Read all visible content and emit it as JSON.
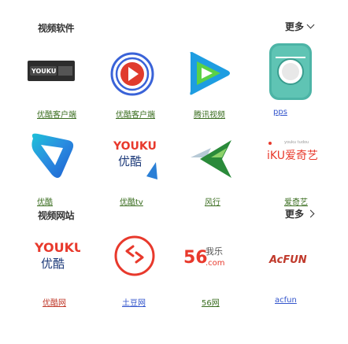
{
  "sections": [
    {
      "title": "视频软件",
      "more_label": "更多",
      "apps": [
        {
          "name": "优酷客户端",
          "icon": "youku-client-icon",
          "color": "#2a2a2a"
        },
        {
          "name": "优酷客户端",
          "icon": "youku-player-icon",
          "color": "#3a63d8"
        },
        {
          "name": "腾讯视频",
          "icon": "tencent-video-icon",
          "color": "#1e9de1"
        },
        {
          "name": "pps",
          "icon": "pps-icon",
          "color": "#3eb370"
        }
      ]
    },
    {
      "title": "视频网站",
      "more_label": "更多",
      "sites": [
        {
          "name": "优酷",
          "icon": "youku-logo-icon"
        },
        {
          "name": "优酷tv",
          "icon": "youku-tudou-logo-icon",
          "logo_line1": "YOUKU",
          "logo_line2": "优酷"
        },
        {
          "name": "风行",
          "icon": "funshion-icon"
        },
        {
          "name": "爱奇艺",
          "icon": "iqiyi-icon",
          "logo_text": "iKU爱奇艺"
        }
      ]
    },
    {
      "title": "视频网站",
      "more_label": "更多",
      "sites": [
        {
          "name": "优酷网",
          "icon": "youku-wordmark-icon",
          "logo_line1": "YOUKU",
          "logo_line2": "优酷"
        },
        {
          "name": "土豆网",
          "icon": "tudou-icon"
        },
        {
          "name": "56网",
          "icon": "56-icon",
          "logo_text": "56",
          "logo_sub": "我乐",
          "logo_com": ".com"
        },
        {
          "name": "acfun",
          "icon": "acfun-icon",
          "logo_text": "AcFUN"
        }
      ]
    }
  ]
}
